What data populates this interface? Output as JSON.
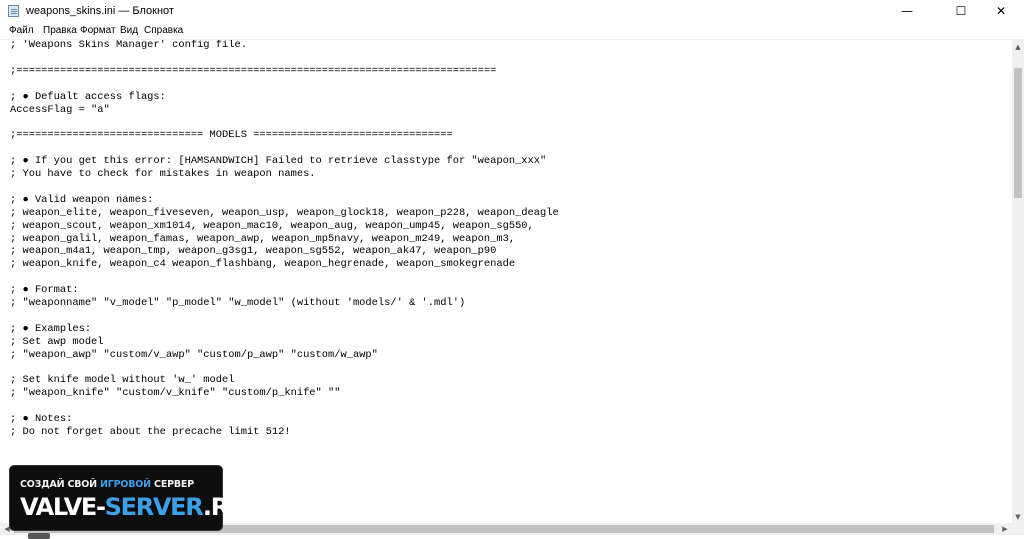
{
  "window": {
    "title": "weapons_skins.ini — Блокнот",
    "minimize_glyph": "—",
    "maximize_glyph": "☐",
    "close_glyph": "✕"
  },
  "menu": [
    "Файл",
    "Правка",
    "Формат",
    "Вид",
    "Справка"
  ],
  "editor_lines": [
    "; 'Weapons Skins Manager' config file.",
    "",
    ";=============================================================================",
    "",
    "; ● Defualt access flags:",
    "AccessFlag = \"a\"",
    "",
    ";============================== MODELS ================================",
    "",
    "; ● If you get this error: [HAMSANDWICH] Failed to retrieve classtype for \"weapon_xxx\"",
    "; You have to check for mistakes in weapon names.",
    "",
    "; ● Valid weapon names:",
    "; weapon_elite, weapon_fiveseven, weapon_usp, weapon_glock18, weapon_p228, weapon_deagle",
    "; weapon_scout, weapon_xm1014, weapon_mac10, weapon_aug, weapon_ump45, weapon_sg550,",
    "; weapon_galil, weapon_famas, weapon_awp, weapon_mp5navy, weapon_m249, weapon_m3,",
    "; weapon_m4a1, weapon_tmp, weapon_g3sg1, weapon_sg552, weapon_ak47, weapon_p90",
    "; weapon_knife, weapon_c4 weapon_flashbang, weapon_hegrenade, weapon_smokegrenade",
    "",
    "; ● Format:",
    "; \"weaponname\" \"v_model\" \"p_model\" \"w_model\" (without 'models/' & '.mdl')",
    "",
    "; ● Examples:",
    "; Set awp model",
    "; \"weapon_awp\" \"custom/v_awp\" \"custom/p_awp\" \"custom/w_awp\"",
    "",
    "; Set knife model without 'w_' model",
    "; \"weapon_knife\" \"custom/v_knife\" \"custom/p_knife\" \"\"",
    "",
    "; ● Notes:",
    "; Do not forget about the precache limit 512!"
  ],
  "watermark": {
    "top_part1": "СОЗДАЙ СВОЙ ",
    "top_part2": "ИГРОВОЙ",
    "top_part3": " СЕРВЕР",
    "main_part1": "VALVE-",
    "main_part2": "SERVER",
    "main_part3": ".RU"
  },
  "scrollbar": {
    "up_glyph": "▲",
    "down_glyph": "▼",
    "left_glyph": "◀",
    "right_glyph": "▶"
  }
}
